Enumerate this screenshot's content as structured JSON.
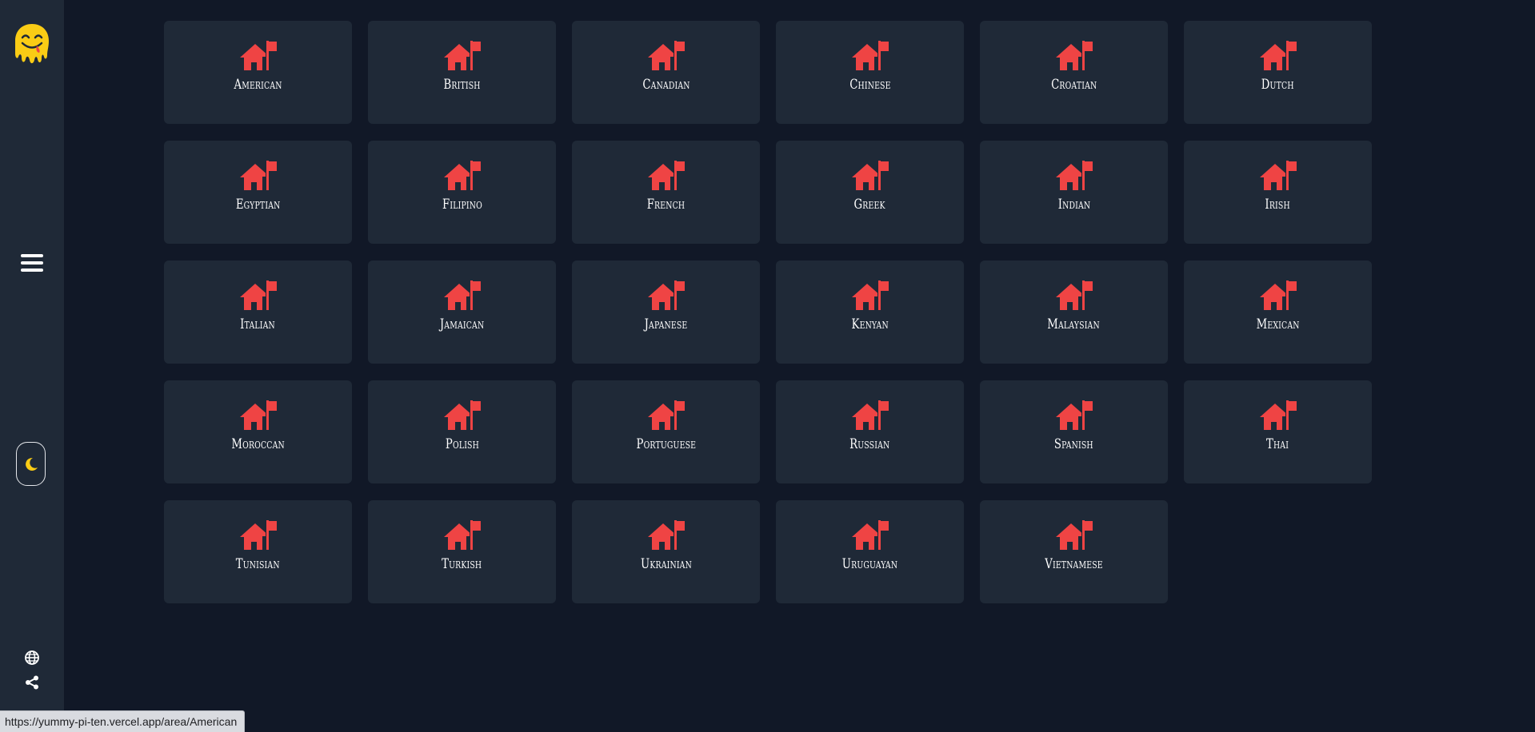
{
  "sidebar": {
    "logo_icon": "drooling-smiley-icon",
    "menu_icon": "hamburger-menu-icon",
    "theme_icon": "moon-icon",
    "language_icon": "globe-icon",
    "share_icon": "share-icon"
  },
  "areas": [
    {
      "label": "American"
    },
    {
      "label": "British"
    },
    {
      "label": "Canadian"
    },
    {
      "label": "Chinese"
    },
    {
      "label": "Croatian"
    },
    {
      "label": "Dutch"
    },
    {
      "label": "Egyptian"
    },
    {
      "label": "Filipino"
    },
    {
      "label": "French"
    },
    {
      "label": "Greek"
    },
    {
      "label": "Indian"
    },
    {
      "label": "Irish"
    },
    {
      "label": "Italian"
    },
    {
      "label": "Jamaican"
    },
    {
      "label": "Japanese"
    },
    {
      "label": "Kenyan"
    },
    {
      "label": "Malaysian"
    },
    {
      "label": "Mexican"
    },
    {
      "label": "Moroccan"
    },
    {
      "label": "Polish"
    },
    {
      "label": "Portuguese"
    },
    {
      "label": "Russian"
    },
    {
      "label": "Spanish"
    },
    {
      "label": "Thai"
    },
    {
      "label": "Tunisian"
    },
    {
      "label": "Turkish"
    },
    {
      "label": "Ukrainian"
    },
    {
      "label": "Uruguayan"
    },
    {
      "label": "Vietnamese"
    }
  ],
  "card_icon": "house-flag-icon",
  "status_bar": {
    "url": "https://yummy-pi-ten.vercel.app/area/American"
  },
  "colors": {
    "background": "#111827",
    "card": "#1f2937",
    "accent_red": "#ef4444",
    "logo_yellow": "#facc15"
  }
}
